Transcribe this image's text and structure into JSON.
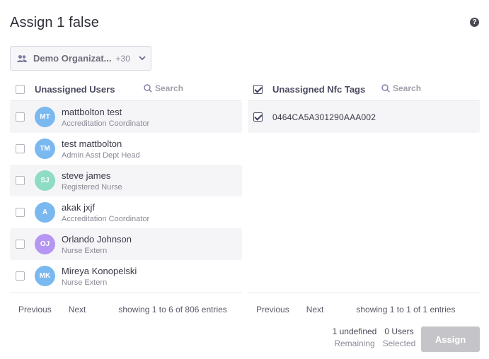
{
  "dialog": {
    "title": "Assign 1 false",
    "help_icon": "question-circle-icon"
  },
  "org_select": {
    "label": "Demo Organizat...",
    "extra_count": "+30",
    "icon": "people-icon"
  },
  "users_panel": {
    "header": "Unassigned Users",
    "search_placeholder": "Search",
    "rows": [
      {
        "initials": "MT",
        "name": "mattbolton test",
        "role": "Accreditation Coordinator",
        "color": "#7ab8f0"
      },
      {
        "initials": "TM",
        "name": "test mattbolton",
        "role": "Admin Asst Dept Head",
        "color": "#7ab8f0"
      },
      {
        "initials": "SJ",
        "name": "steve james",
        "role": "Registered Nurse",
        "color": "#8ddcc3"
      },
      {
        "initials": "A",
        "name": "akak jxjf",
        "role": "Accreditation Coordinator",
        "color": "#7ab8f0"
      },
      {
        "initials": "OJ",
        "name": "Orlando Johnson",
        "role": "Nurse Extern",
        "color": "#b596f3"
      },
      {
        "initials": "MK",
        "name": "Mireya Konopelski",
        "role": "Nurse Extern",
        "color": "#7ab8f0"
      }
    ],
    "pager": {
      "prev": "Previous",
      "next": "Next",
      "entries": "showing 1 to 6 of 806 entries"
    }
  },
  "tags_panel": {
    "header": "Unassigned Nfc Tags",
    "search_placeholder": "Search",
    "header_checked": true,
    "rows": [
      {
        "code": "0464CA5A301290AAA002",
        "checked": true
      }
    ],
    "pager": {
      "prev": "Previous",
      "next": "Next",
      "entries": "showing 1 to 1 of 1 entries"
    }
  },
  "footer": {
    "remaining_value": "1 undefined",
    "remaining_label": "Remaining",
    "selected_value": "0 Users",
    "selected_label": "Selected",
    "assign_label": "Assign"
  }
}
